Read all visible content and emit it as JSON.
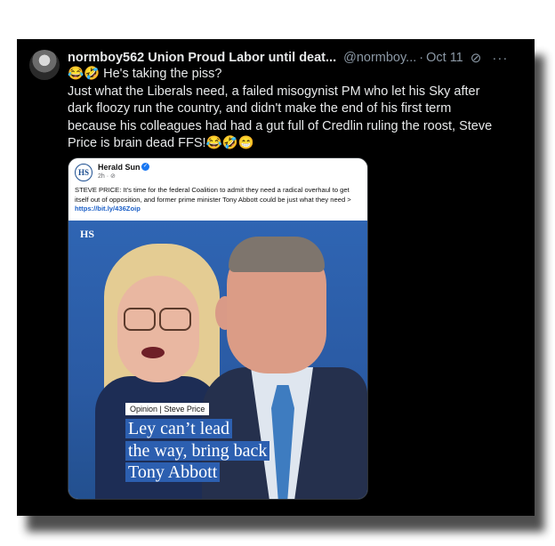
{
  "tweet": {
    "display_name": "normboy562 Union Proud Labor until deat...",
    "handle": "@normboy...",
    "separator": "·",
    "date": "Oct 11",
    "grok_icon": "grok-icon",
    "more_icon": "more-icon",
    "more_glyph": "···",
    "lines": [
      "😂🤣 He's taking the piss?",
      "Just what the Liberals need, a failed misogynist PM who let his Sky after",
      "dark floozy run the country, and didn't make the end of his first term",
      "because his colleagues had had a gut full of Credlin ruling the roost, Steve",
      "Price is brain dead FFS!😂🤣😁"
    ]
  },
  "card": {
    "logo_text": "HS",
    "publisher": "Herald Sun",
    "verified_glyph": "✓",
    "meta": "2h · ⊘",
    "post_text": "STEVE PRICE: It's time for the federal Coalition to admit they need a radical overhaul to get itself out of opposition, and former prime minister Tony Abbott could be just what they need > ",
    "post_link": "https://bit.ly/436Zoip",
    "photo_logo": "HS",
    "opinion_tag": "Opinion | Steve Price",
    "headline_lines": [
      "Ley can’t lead",
      "the way, bring back",
      "Tony Abbott"
    ]
  },
  "colors": {
    "tweet_bg": "#000000",
    "text": "#e7e9ea",
    "muted": "#8b98a5",
    "brand_blue": "#1d4f91",
    "headline_bg": "#2c5fb0",
    "link": "#1b5fc7"
  }
}
